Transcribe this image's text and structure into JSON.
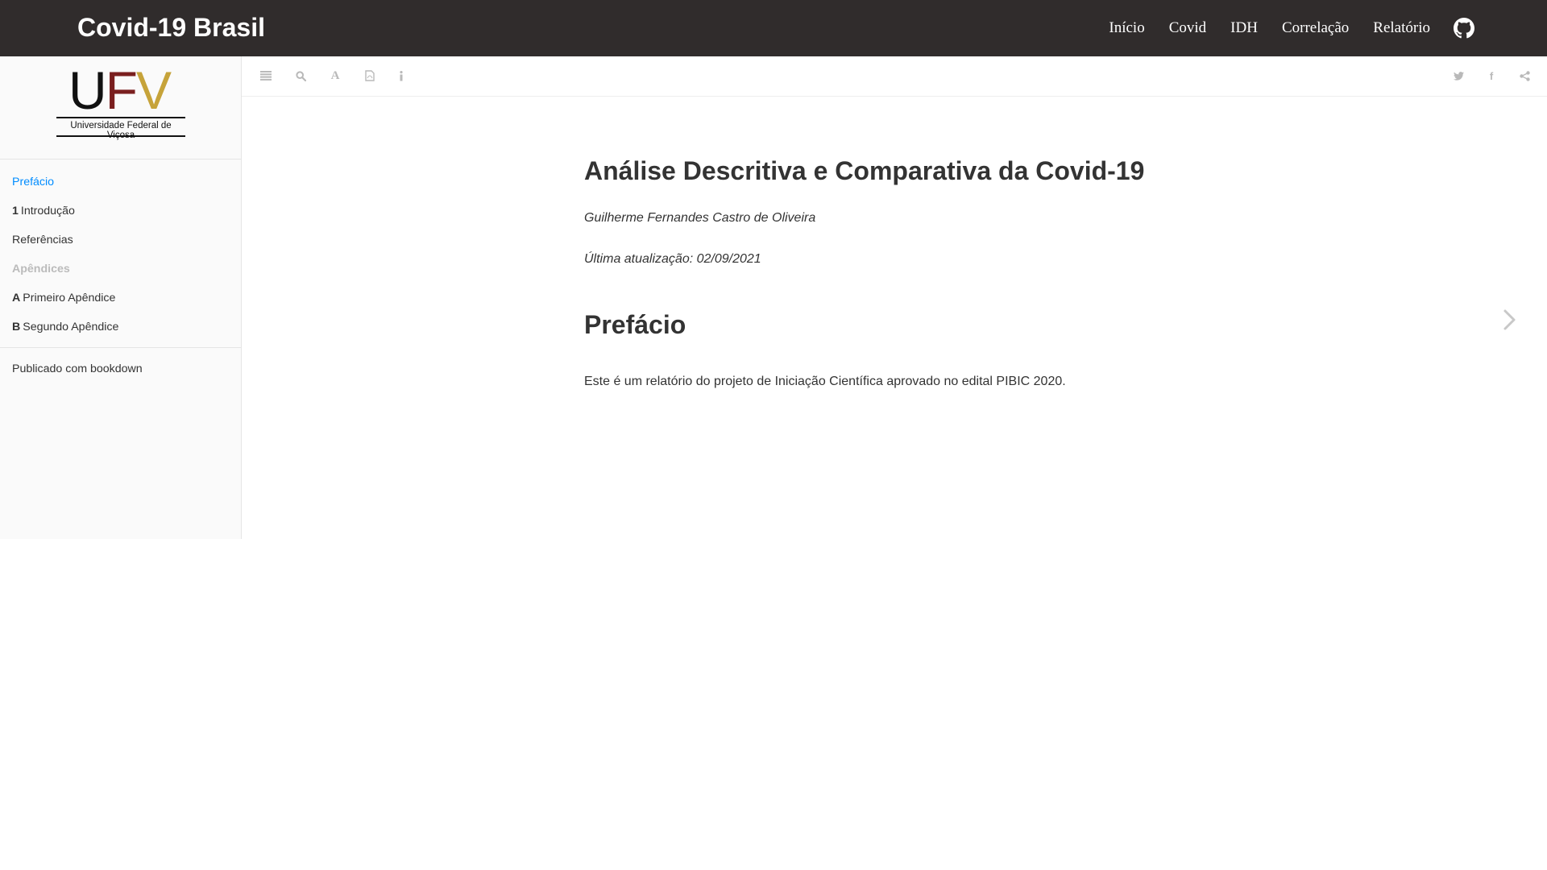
{
  "navbar": {
    "brand": "Covid-19 Brasil",
    "links": [
      "Início",
      "Covid",
      "IDH",
      "Correlação",
      "Relatório"
    ]
  },
  "sidebar": {
    "logo": {
      "letters": "UFV",
      "caption": "Universidade Federal de Viçosa"
    },
    "toc": {
      "prefacio": "Prefácio",
      "introducao_num": "1",
      "introducao": "Introdução",
      "referencias": "Referências",
      "apendices": "Apêndices",
      "apendice_a_num": "A",
      "apendice_a": "Primeiro Apêndice",
      "apendice_b_num": "B",
      "apendice_b": "Segundo Apêndice"
    },
    "published": "Publicado com bookdown"
  },
  "toolbar": {
    "left_icons": [
      "menu-icon",
      "search-icon",
      "font-icon",
      "pdf-icon",
      "info-icon"
    ],
    "right_icons": [
      "twitter-icon",
      "facebook-icon",
      "share-icon"
    ]
  },
  "content": {
    "title": "Análise Descritiva e Comparativa da Covid-19",
    "author": "Guilherme Fernandes Castro de Oliveira",
    "date": "Última atualização: 02/09/2021",
    "section_title": "Prefácio",
    "paragraph": "Este é um relatório do projeto de Iniciação Científica aprovado no edital PIBIC 2020."
  },
  "colors": {
    "navbar_bg": "#302c2c",
    "active_link": "#008cff",
    "ufv_red": "#7a1f1f",
    "ufv_gold": "#c6a33a"
  }
}
